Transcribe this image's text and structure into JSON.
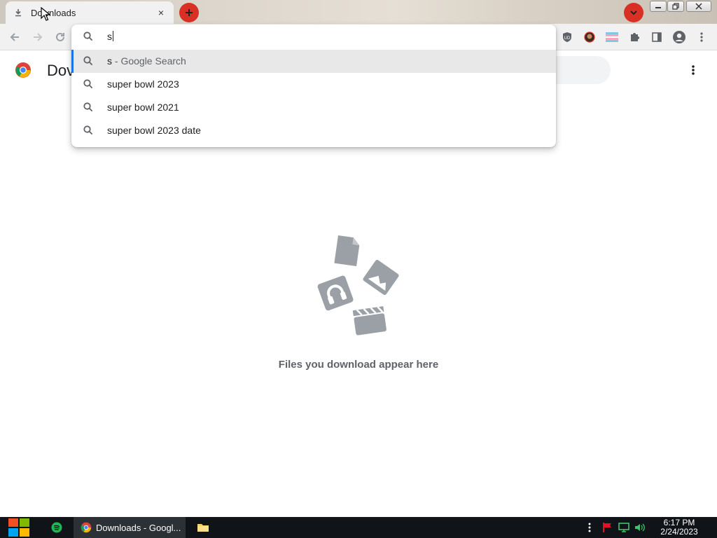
{
  "tab": {
    "title": "Downloads",
    "close_glyph": "×",
    "icon": "download-icon"
  },
  "toolbar": {
    "back_icon": "arrow-left-icon",
    "forward_icon": "arrow-right-icon",
    "reload_icon": "reload-icon",
    "extensions": [
      "ublock-icon",
      "avatar-extension-icon",
      "flag-extension-icon",
      "puzzle-icon",
      "side-panel-icon",
      "profile-icon",
      "more-icon"
    ]
  },
  "page": {
    "title": "Dov",
    "empty_text": "Files you download appear here"
  },
  "omnibox": {
    "typed_text": "s",
    "suggestions": [
      {
        "main": "s",
        "suffix": " - Google Search"
      },
      {
        "main": "super bowl 2023",
        "suffix": ""
      },
      {
        "main": "super bowl 2021",
        "suffix": ""
      },
      {
        "main": "super bowl 2023 date",
        "suffix": ""
      }
    ]
  },
  "taskbar": {
    "chrome_label": "Downloads - Googl...",
    "time": "6:17 PM",
    "date": "2/24/2023"
  },
  "colors": {
    "accent_red": "#d93025",
    "selection_blue": "#1a73e8",
    "taskbar_bg": "#101418",
    "illustration_grey": "#9aa0a6"
  }
}
